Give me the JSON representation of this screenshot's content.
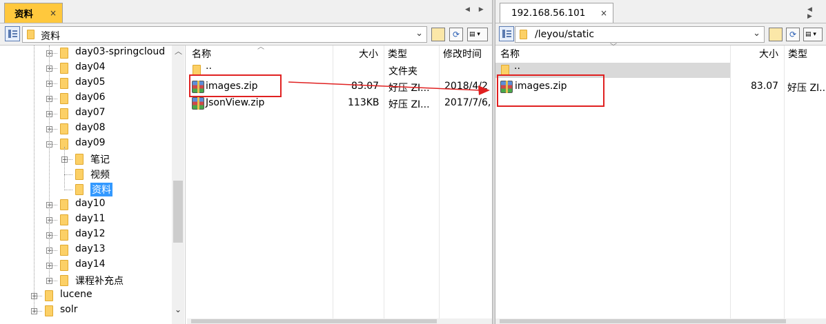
{
  "left": {
    "tab_label": "资料",
    "path": "资料",
    "tree": [
      {
        "label": "day03-springcloud",
        "level": 1,
        "expander": "+"
      },
      {
        "label": "day04",
        "level": 1,
        "expander": "+"
      },
      {
        "label": "day05",
        "level": 1,
        "expander": "+"
      },
      {
        "label": "day06",
        "level": 1,
        "expander": "+"
      },
      {
        "label": "day07",
        "level": 1,
        "expander": "+"
      },
      {
        "label": "day08",
        "level": 1,
        "expander": "+"
      },
      {
        "label": "day09",
        "level": 1,
        "expander": "-"
      },
      {
        "label": "笔记",
        "level": 2,
        "expander": "+"
      },
      {
        "label": "视频",
        "level": 2,
        "expander": ""
      },
      {
        "label": "资料",
        "level": 2,
        "expander": "",
        "selected": true
      },
      {
        "label": "day10",
        "level": 1,
        "expander": "+"
      },
      {
        "label": "day11",
        "level": 1,
        "expander": "+"
      },
      {
        "label": "day12",
        "level": 1,
        "expander": "+"
      },
      {
        "label": "day13",
        "level": 1,
        "expander": "+"
      },
      {
        "label": "day14",
        "level": 1,
        "expander": "+"
      },
      {
        "label": "课程补充点",
        "level": 1,
        "expander": "+"
      },
      {
        "label": "lucene",
        "level": 0,
        "expander": "+"
      },
      {
        "label": "solr",
        "level": 0,
        "expander": "+"
      }
    ],
    "columns": {
      "name": "名称",
      "size": "大小",
      "type": "类型",
      "modified": "修改时间"
    },
    "files": [
      {
        "name": "..",
        "size": "",
        "type": "文件夹",
        "modified": "",
        "icon": "folder-icon"
      },
      {
        "name": "images.zip",
        "size": "83.07",
        "type": "好压 ZI...",
        "modified": "2018/4/2",
        "icon": "zip-icon"
      },
      {
        "name": "JsonView.zip",
        "size": "113KB",
        "type": "好压 ZI...",
        "modified": "2017/7/6,",
        "icon": "zip-icon"
      }
    ]
  },
  "right": {
    "tab_label": "192.168.56.101",
    "tab_close": "×",
    "path": "/leyou/static",
    "columns": {
      "name": "名称",
      "size": "大小",
      "type": "类型"
    },
    "files": [
      {
        "name": "..",
        "size": "",
        "type": "",
        "icon": "folder-icon"
      },
      {
        "name": "images.zip",
        "size": "83.07",
        "type": "好压 ZI...",
        "icon": "zip-icon"
      }
    ]
  },
  "colors": {
    "highlight": "#e02020",
    "selection": "#3399ff",
    "folder": "#fcd066"
  }
}
